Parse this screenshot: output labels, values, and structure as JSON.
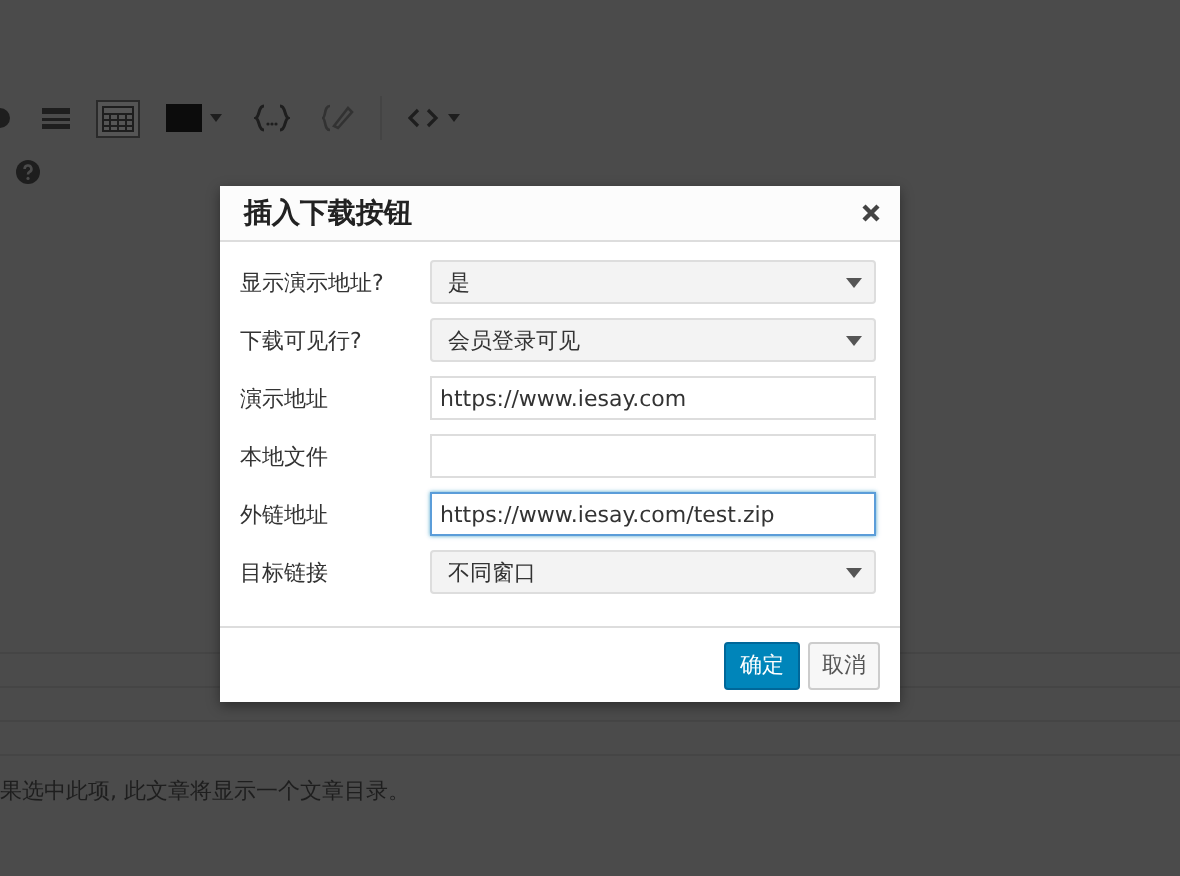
{
  "toolbar": [
    {
      "kind": "rows",
      "active": false,
      "disabled": false
    },
    {
      "kind": "table",
      "active": true,
      "disabled": false
    },
    {
      "kind": "swatch",
      "active": false,
      "disabled": false
    },
    {
      "kind": "braces",
      "active": false,
      "disabled": false
    },
    {
      "kind": "pencil",
      "active": false,
      "disabled": true
    },
    {
      "kind": "code",
      "active": false,
      "disabled": false
    }
  ],
  "background_note": "果选中此项, 此文章将显示一个文章目录。",
  "dialog": {
    "title": "插入下载按钮",
    "fields": [
      {
        "label": "显示演示地址?",
        "kind": "select",
        "value": "是",
        "focused": false
      },
      {
        "label": "下载可见行?",
        "kind": "select",
        "value": "会员登录可见",
        "focused": false
      },
      {
        "label": "演示地址",
        "kind": "input",
        "value": "https://www.iesay.com",
        "focused": false
      },
      {
        "label": "本地文件",
        "kind": "input",
        "focused": false
      },
      {
        "label": "外链地址",
        "kind": "input",
        "value": "https://www.iesay.com/test.zip",
        "focused": true
      },
      {
        "label": "目标链接",
        "kind": "select",
        "value": "不同窗口",
        "focused": false
      }
    ],
    "buttons": [
      {
        "label": "确定",
        "kind": "primary"
      },
      {
        "label": "取消",
        "kind": "secondary"
      }
    ]
  }
}
